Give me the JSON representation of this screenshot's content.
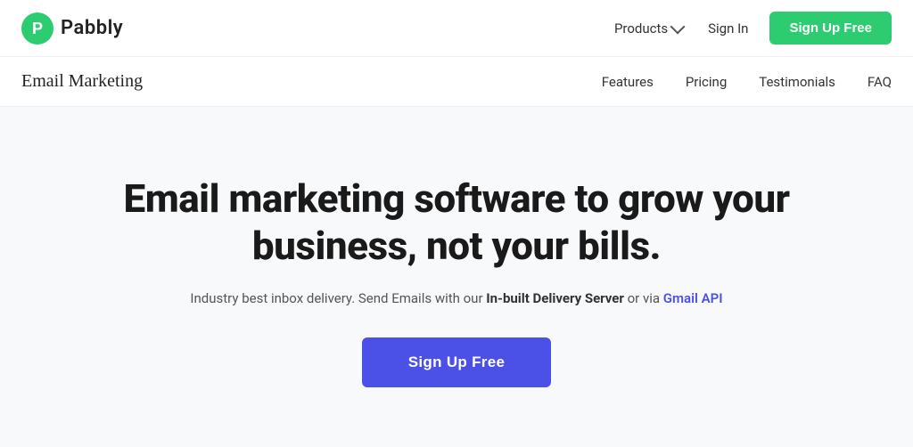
{
  "topnav": {
    "logo_text": "Pabbly",
    "products_label": "Products",
    "signin_label": "Sign In",
    "signup_label": "Sign Up Free"
  },
  "subnav": {
    "title": "Email Marketing",
    "links": [
      {
        "label": "Features",
        "id": "features"
      },
      {
        "label": "Pricing",
        "id": "pricing"
      },
      {
        "label": "Testimonials",
        "id": "testimonials"
      },
      {
        "label": "FAQ",
        "id": "faq"
      }
    ]
  },
  "hero": {
    "headline": "Email marketing software to grow your business, not your bills.",
    "subtext_before": "Industry best inbox delivery. Send Emails with our ",
    "subtext_bold": "In-built Delivery Server",
    "subtext_middle": " or via ",
    "subtext_link": "Gmail API",
    "cta_label": "Sign Up Free"
  },
  "colors": {
    "green": "#2ecc71",
    "blue_cta": "#4b50e6",
    "text_dark": "#1a1a1a",
    "text_medium": "#333333",
    "text_light": "#555555"
  }
}
